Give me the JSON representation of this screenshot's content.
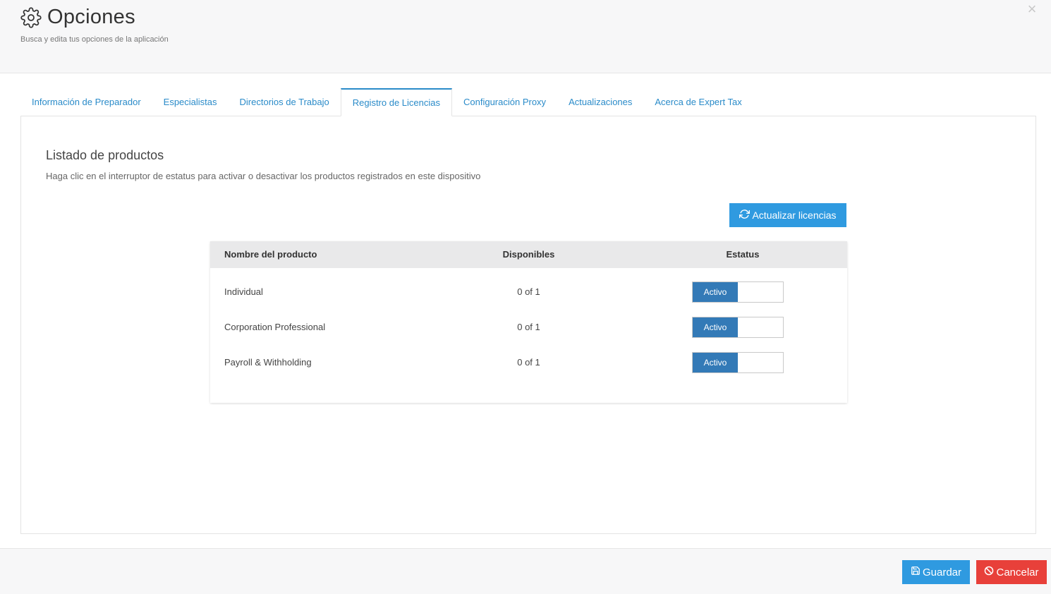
{
  "header": {
    "title": "Opciones",
    "subtitle": "Busca y edita tus opciones de la aplicación",
    "title_icon": "gear-icon",
    "close_icon": "close-icon",
    "close_glyph": "×"
  },
  "tabs": [
    {
      "label": "Información de Preparador",
      "active": false
    },
    {
      "label": "Especialistas",
      "active": false
    },
    {
      "label": "Directorios de Trabajo",
      "active": false
    },
    {
      "label": "Registro de Licencias",
      "active": true
    },
    {
      "label": "Configuración Proxy",
      "active": false
    },
    {
      "label": "Actualizaciones",
      "active": false
    },
    {
      "label": "Acerca de Expert Tax",
      "active": false
    }
  ],
  "panel": {
    "title": "Listado de productos",
    "description": "Haga clic en el interruptor de estatus para activar o desactivar los productos registrados en este dispositivo",
    "refresh_label": "Actualizar licencias",
    "refresh_icon": "refresh-icon"
  },
  "table": {
    "headers": {
      "name": "Nombre del producto",
      "available": "Disponibles",
      "status": "Estatus"
    },
    "rows": [
      {
        "name": "Individual",
        "available": "0 of 1",
        "status": "Activo"
      },
      {
        "name": "Corporation Professional",
        "available": "0 of 1",
        "status": "Activo"
      },
      {
        "name": "Payroll & Withholding",
        "available": "0 of 1",
        "status": "Activo"
      }
    ]
  },
  "footer": {
    "save_label": "Guardar",
    "save_icon": "save-icon",
    "cancel_label": "Cancelar",
    "cancel_icon": "ban-icon"
  },
  "colors": {
    "accent": "#2f9ae0",
    "toggle_on": "#337ab7",
    "danger": "#e8403a",
    "tab_text": "#2a8bc9"
  }
}
